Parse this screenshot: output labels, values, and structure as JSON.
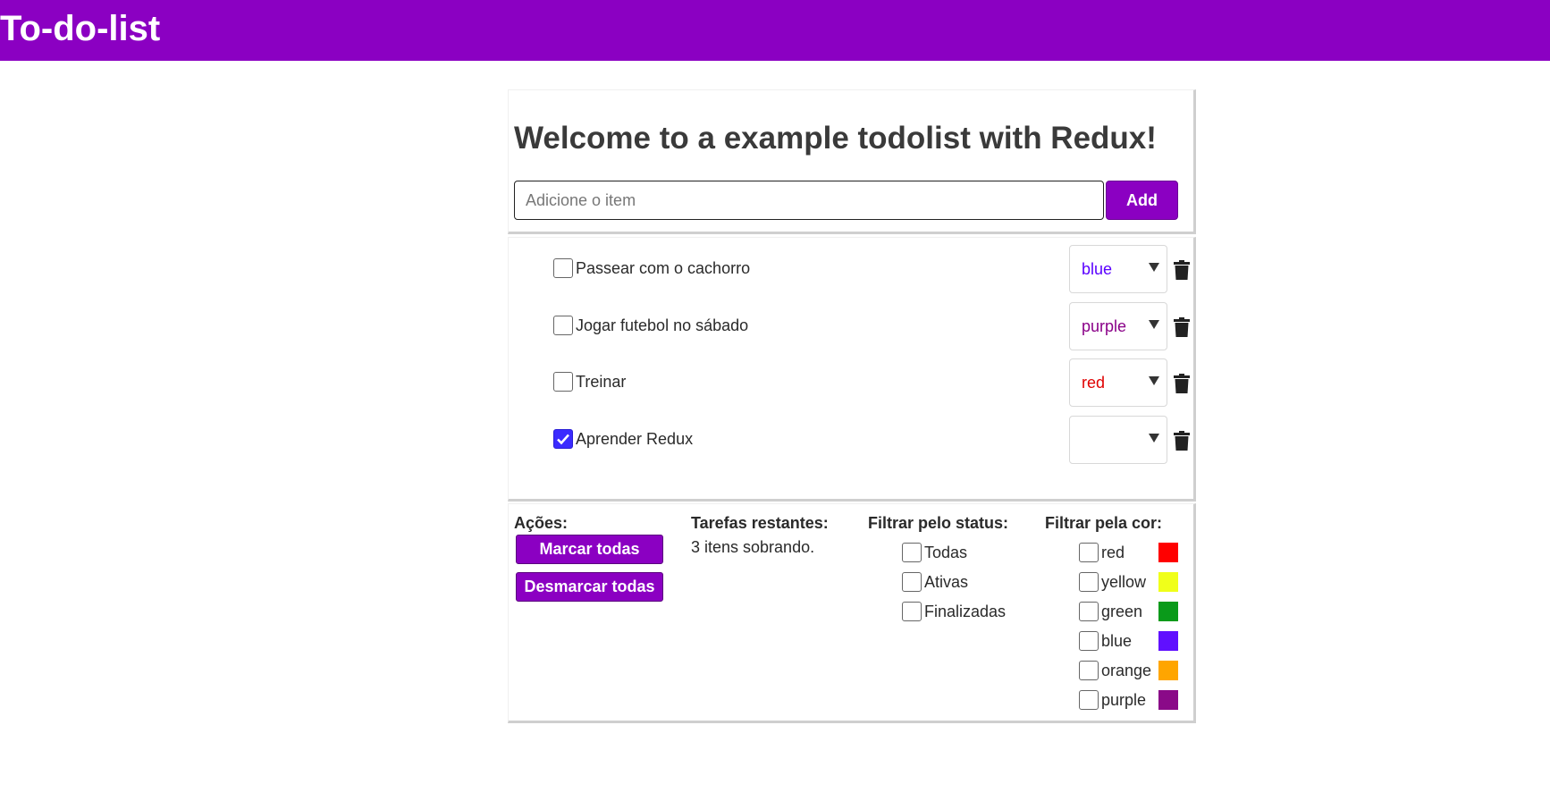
{
  "app": {
    "title": "To-do-list"
  },
  "header": {
    "welcome": "Welcome to a example todolist with Redux!",
    "input_placeholder": "Adicione o item",
    "input_value": "",
    "add_label": "Add"
  },
  "todos": [
    {
      "text": "Passear com o cachorro",
      "done": false,
      "color": "blue",
      "color_hex": "#5a00ff"
    },
    {
      "text": "Jogar futebol no sábado",
      "done": false,
      "color": "purple",
      "color_hex": "#8a0088"
    },
    {
      "text": "Treinar",
      "done": false,
      "color": "red",
      "color_hex": "#e00000"
    },
    {
      "text": "Aprender Redux",
      "done": true,
      "color": "",
      "color_hex": "#333333"
    }
  ],
  "footer": {
    "actions_label": "Ações:",
    "mark_all": "Marcar todas",
    "unmark_all": "Desmarcar todas",
    "remaining_label": "Tarefas restantes:",
    "remaining_text": "3 itens sobrando.",
    "status_label": "Filtrar pelo status:",
    "status_options": [
      "Todas",
      "Ativas",
      "Finalizadas"
    ],
    "color_label": "Filtrar pela cor:",
    "color_options": [
      {
        "name": "red",
        "hex": "#ff0000"
      },
      {
        "name": "yellow",
        "hex": "#f0ff1a"
      },
      {
        "name": "green",
        "hex": "#0a9a1a"
      },
      {
        "name": "blue",
        "hex": "#6010ff"
      },
      {
        "name": "orange",
        "hex": "#ffa500"
      },
      {
        "name": "purple",
        "hex": "#8a0a88"
      }
    ]
  },
  "colors": {
    "brand": "#8b00c2",
    "check_accent": "#3b2bff"
  },
  "icons": {
    "delete": "trash-icon",
    "dropdown": "chevron-down-icon",
    "check": "check-icon"
  }
}
